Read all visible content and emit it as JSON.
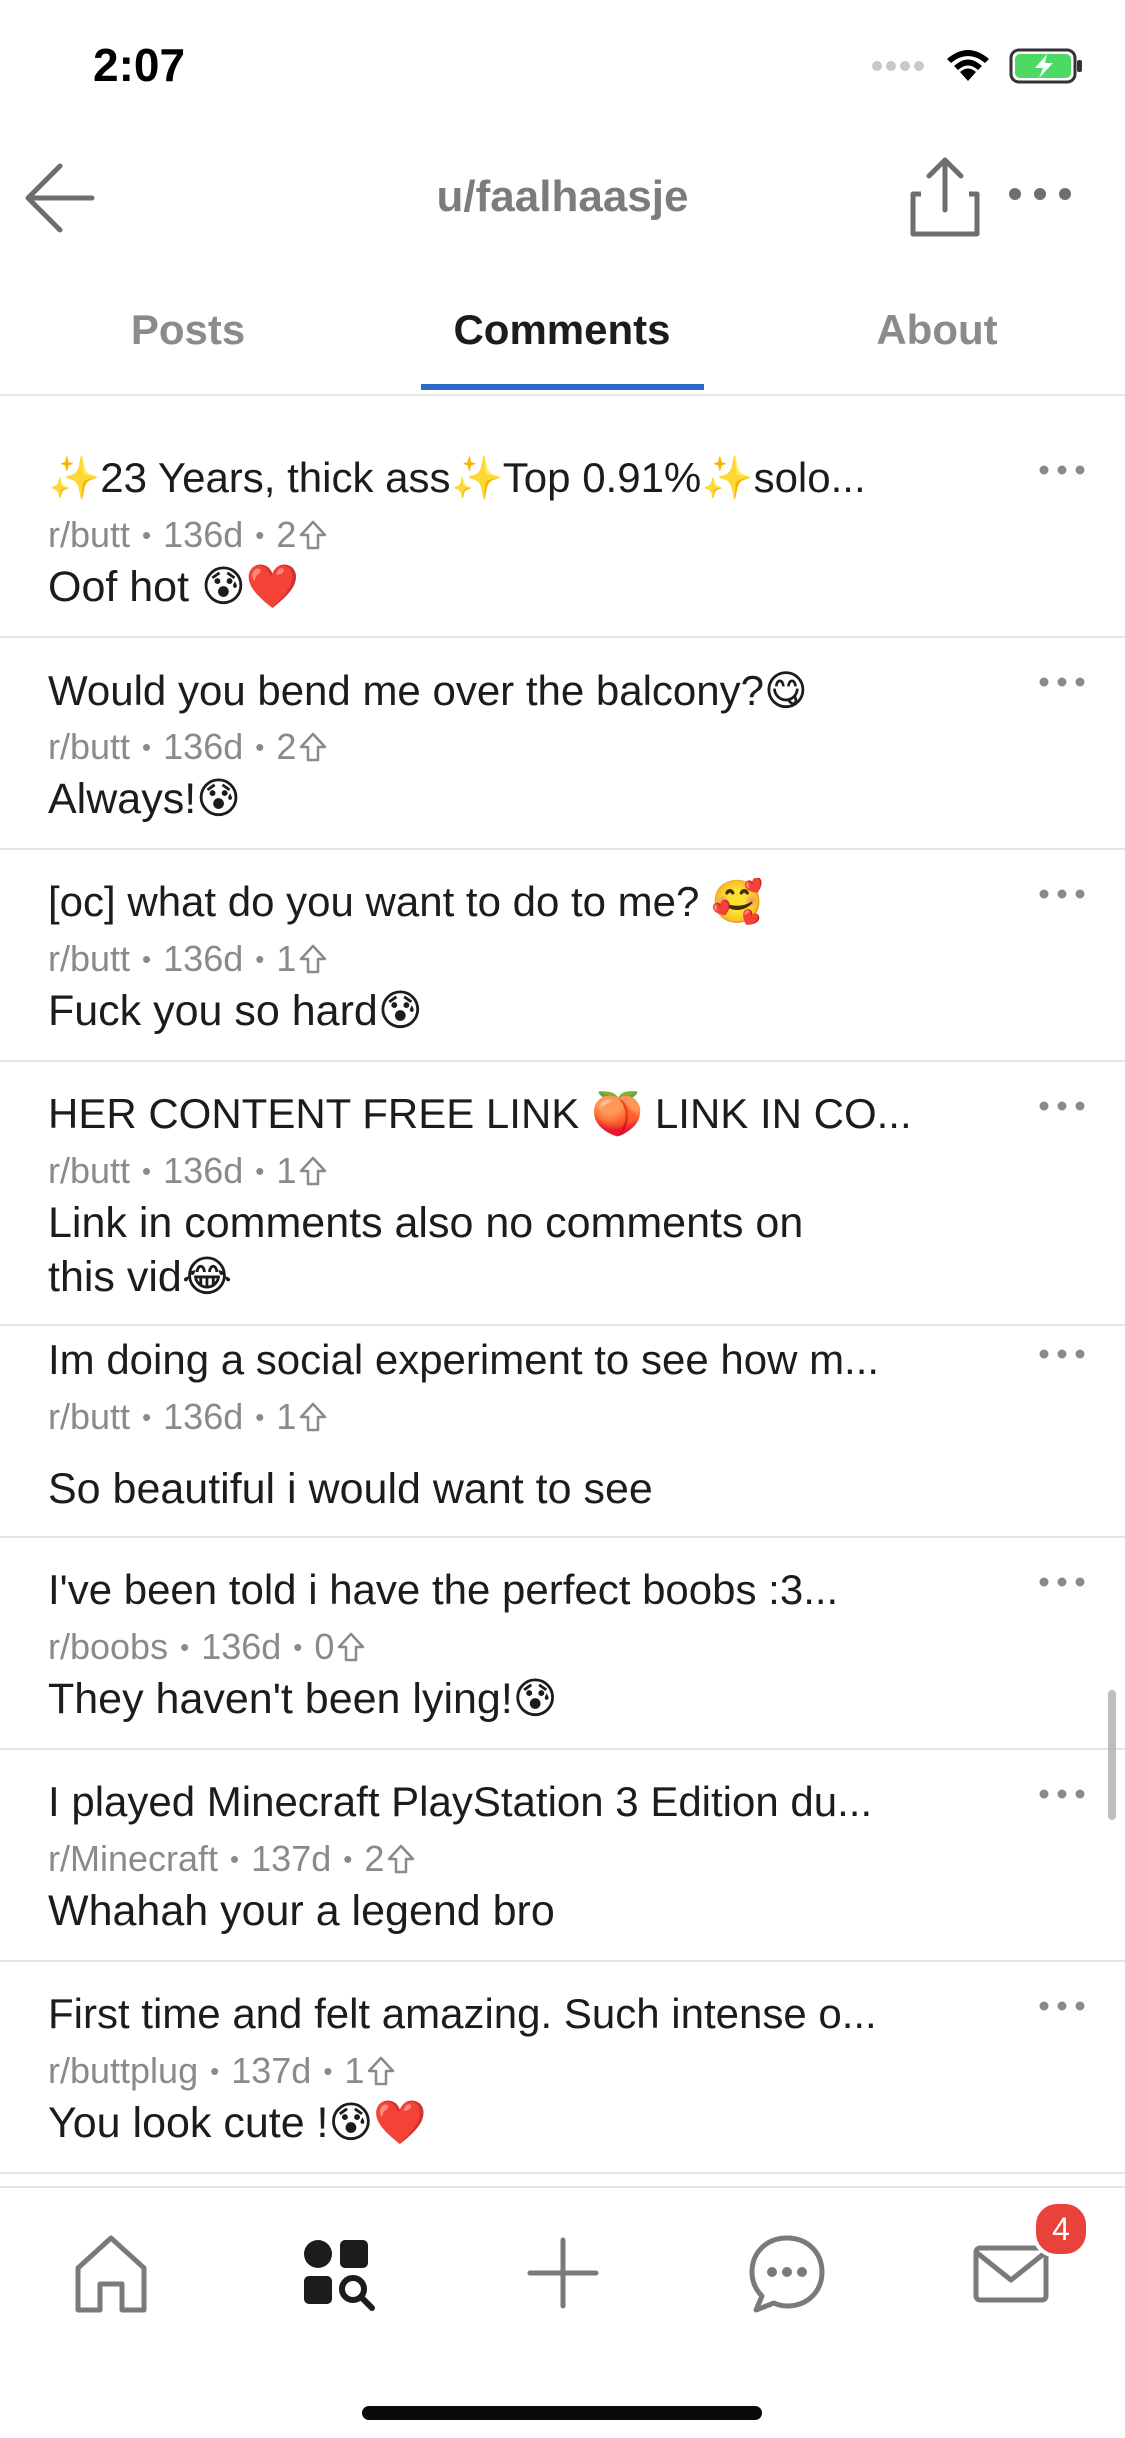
{
  "status": {
    "time": "2:07"
  },
  "header": {
    "title": "u/faalhaasje"
  },
  "tabs": [
    {
      "label": "Posts",
      "active": false
    },
    {
      "label": "Comments",
      "active": true
    },
    {
      "label": "About",
      "active": false
    }
  ],
  "comments": [
    {
      "title": "✨23 Years, thick ass✨Top 0.91%✨solo...",
      "subreddit": "r/butt",
      "age": "136d",
      "votes": "2",
      "body": "Oof hot 😰❤️"
    },
    {
      "title": "Would you bend me over the balcony?😋",
      "subreddit": "r/butt",
      "age": "136d",
      "votes": "2",
      "body": "Always!😰"
    },
    {
      "title": "[oc] what do you want to do to me? 🥰",
      "subreddit": "r/butt",
      "age": "136d",
      "votes": "1",
      "body": "Fuck you so hard😰"
    },
    {
      "title": "HER CONTENT FREE LINK 🍑 LINK IN CO...",
      "subreddit": "r/butt",
      "age": "136d",
      "votes": "1",
      "body": "Link in comments also no comments on this vid😂"
    },
    {
      "title": "Im doing a social experiment to see how m...",
      "subreddit": "r/butt",
      "age": "136d",
      "votes": "1",
      "body": "So beautiful i would want to see"
    },
    {
      "title": "I've been told i have the perfect boobs :3...",
      "subreddit": "r/boobs",
      "age": "136d",
      "votes": "0",
      "body": "They haven't been lying!😰"
    },
    {
      "title": "I played Minecraft PlayStation 3 Edition du...",
      "subreddit": "r/Minecraft",
      "age": "137d",
      "votes": "2",
      "body": "Whahah your a legend bro"
    },
    {
      "title": "First time and felt amazing. Such intense o...",
      "subreddit": "r/buttplug",
      "age": "137d",
      "votes": "1",
      "body": "You look cute !😰❤️"
    }
  ],
  "tab_bar": {
    "inbox_badge": "4"
  },
  "colors": {
    "accent": "#2a6bc7",
    "badge": "#e8423a",
    "battery": "#4cd964"
  }
}
